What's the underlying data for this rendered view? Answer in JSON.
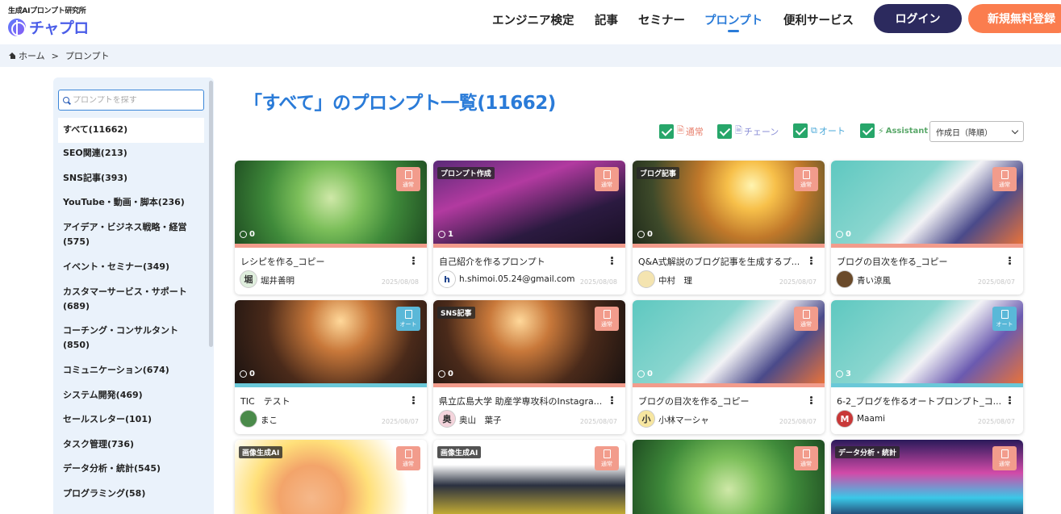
{
  "header": {
    "logo_sub": "生成AIプロンプト研究所",
    "logo_main": "チャプロ",
    "nav": [
      "エンジニア検定",
      "記事",
      "セミナー",
      "プロンプト",
      "便利サービス"
    ],
    "active_nav": "プロンプト",
    "login_label": "ログイン",
    "signup_label": "新規無料登録"
  },
  "breadcrumb": {
    "home": "ホーム",
    "separator": ">",
    "current": "プロンプト"
  },
  "sidebar": {
    "search_placeholder": "プロンプトを探す",
    "categories": [
      "すべて(11662)",
      "SEO関連(213)",
      "SNS記事(393)",
      "YouTube・動画・脚本(236)",
      "アイデア・ビジネス戦略・経営 (575)",
      "イベント・セミナー(349)",
      "カスタマーサービス・サポート (689)",
      "コーチング・コンサルタント (850)",
      "コミュニケーション(674)",
      "システム開発(469)",
      "セールスレター(101)",
      "タスク管理(736)",
      "データ分析・統計(545)",
      "プログラミング(58)"
    ]
  },
  "main": {
    "title": "「すべて」のプロンプト一覧(11662)",
    "filters": [
      {
        "label": "通常",
        "color": "#e8826f",
        "icon": "document-icon"
      },
      {
        "label": "チェーン",
        "color": "#8a8ed6",
        "icon": "chain-icon"
      },
      {
        "label": "オート",
        "color": "#4aa8d8",
        "icon": "copy-icon"
      },
      {
        "label": "Assistant",
        "color": "#5aa86a",
        "icon": "lightning-icon"
      }
    ],
    "sort_value": "作成日（降順）"
  },
  "cards": [
    {
      "tag": "",
      "type": "通常",
      "likes": "0",
      "title": "レシピを作る_コピー",
      "author": "堀井善明",
      "avatar": "堀",
      "date": "2025/08/08"
    },
    {
      "tag": "プロンプト作成",
      "type": "通常",
      "likes": "1",
      "title": "自己紹介を作るプロンプト",
      "author": "h.shimoi.05.24@gmail.com",
      "avatar": "h",
      "date": "2025/08/08"
    },
    {
      "tag": "ブログ記事",
      "type": "通常",
      "likes": "0",
      "title": "Q&A式解説のブログ記事を生成するプ...",
      "author": "中村　理",
      "avatar": "",
      "date": "2025/08/07"
    },
    {
      "tag": "",
      "type": "通常",
      "likes": "0",
      "title": "ブログの目次を作る_コピー",
      "author": "青い涼風",
      "avatar": "",
      "date": "2025/08/07"
    },
    {
      "tag": "",
      "type": "オート",
      "likes": "0",
      "title": "TIC　テスト",
      "author": "まこ",
      "avatar": "",
      "date": "2025/08/07"
    },
    {
      "tag": "SNS記事",
      "type": "通常",
      "likes": "0",
      "title": "県立広島大学 助産学専攻科のInstagra...",
      "author": "奥山　葉子",
      "avatar": "奥",
      "date": "2025/08/07"
    },
    {
      "tag": "",
      "type": "通常",
      "likes": "0",
      "title": "ブログの目次を作る_コピー",
      "author": "小林マーシャ",
      "avatar": "小",
      "date": "2025/08/07"
    },
    {
      "tag": "",
      "type": "オート",
      "likes": "3",
      "title": "6-2_ブログを作るオートプロンプト_コ...",
      "author": "Maami",
      "avatar": "M",
      "date": "2025/08/07"
    },
    {
      "tag": "画像生成AI",
      "type": "通常",
      "likes": "",
      "title": "",
      "author": "",
      "avatar": "",
      "date": ""
    },
    {
      "tag": "画像生成AI",
      "type": "通常",
      "likes": "",
      "title": "",
      "author": "",
      "avatar": "",
      "date": ""
    },
    {
      "tag": "",
      "type": "通常",
      "likes": "",
      "title": "",
      "author": "",
      "avatar": "",
      "date": ""
    },
    {
      "tag": "データ分析・統計",
      "type": "通常",
      "likes": "",
      "title": "",
      "author": "",
      "avatar": "",
      "date": ""
    }
  ]
}
